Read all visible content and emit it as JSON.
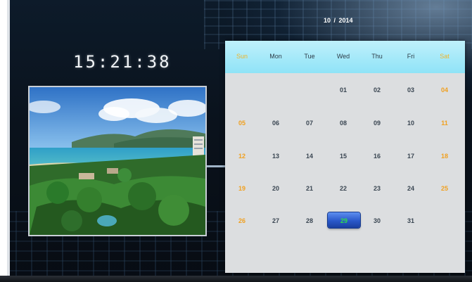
{
  "clock": {
    "time": "15:21:38"
  },
  "month_label": "10  /  2014",
  "calendar": {
    "weekdays": [
      "Sun",
      "Mon",
      "Tue",
      "Wed",
      "Thu",
      "Fri",
      "Sat"
    ],
    "weeks": [
      [
        "",
        "",
        "",
        "01",
        "02",
        "03",
        "04"
      ],
      [
        "05",
        "06",
        "07",
        "08",
        "09",
        "10",
        "11"
      ],
      [
        "12",
        "13",
        "14",
        "15",
        "16",
        "17",
        "18"
      ],
      [
        "19",
        "20",
        "21",
        "22",
        "23",
        "24",
        "25"
      ],
      [
        "26",
        "27",
        "28",
        "29",
        "30",
        "31",
        ""
      ]
    ],
    "today": "29"
  },
  "colors": {
    "header_bg": "#9fe7f8",
    "weekend": "#f0a020",
    "today_highlight": "#3a6ee0",
    "today_text": "#2fe04a"
  },
  "photo": {
    "subject": "tropical-coast-landscape"
  }
}
